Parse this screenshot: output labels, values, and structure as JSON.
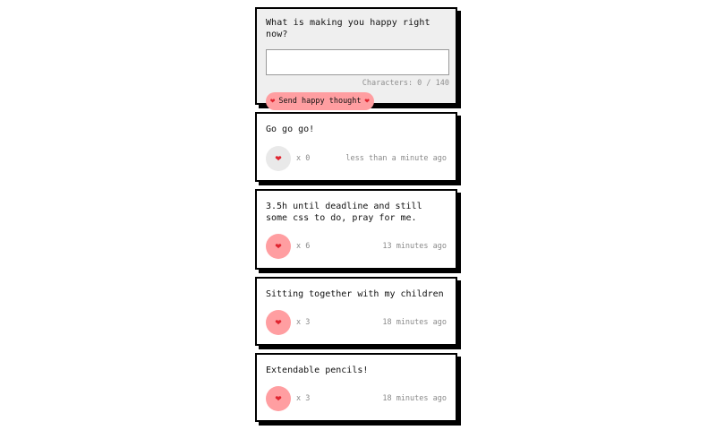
{
  "compose": {
    "title": "What is making you happy right now?",
    "textarea_value": "",
    "char_count": "Characters: 0 / 140",
    "send_label": "Send happy thought",
    "heart_glyph": "❤"
  },
  "thoughts": [
    {
      "message": "Go go go!",
      "likes": "x 0",
      "time": "less than a minute ago",
      "liked": false
    },
    {
      "message": "3.5h until deadline and still some css to do, pray for me.",
      "likes": "x 6",
      "time": "13 minutes ago",
      "liked": true
    },
    {
      "message": "Sitting together with my children",
      "likes": "x 3",
      "time": "18 minutes ago",
      "liked": true
    },
    {
      "message": "Extendable pencils!",
      "likes": "x 3",
      "time": "18 minutes ago",
      "liked": true
    }
  ],
  "colors": {
    "accent_pink": "#ff9ea1",
    "heart_red": "#e0242f",
    "unliked_grey": "#e9e9e9",
    "compose_bg": "#efefef"
  }
}
